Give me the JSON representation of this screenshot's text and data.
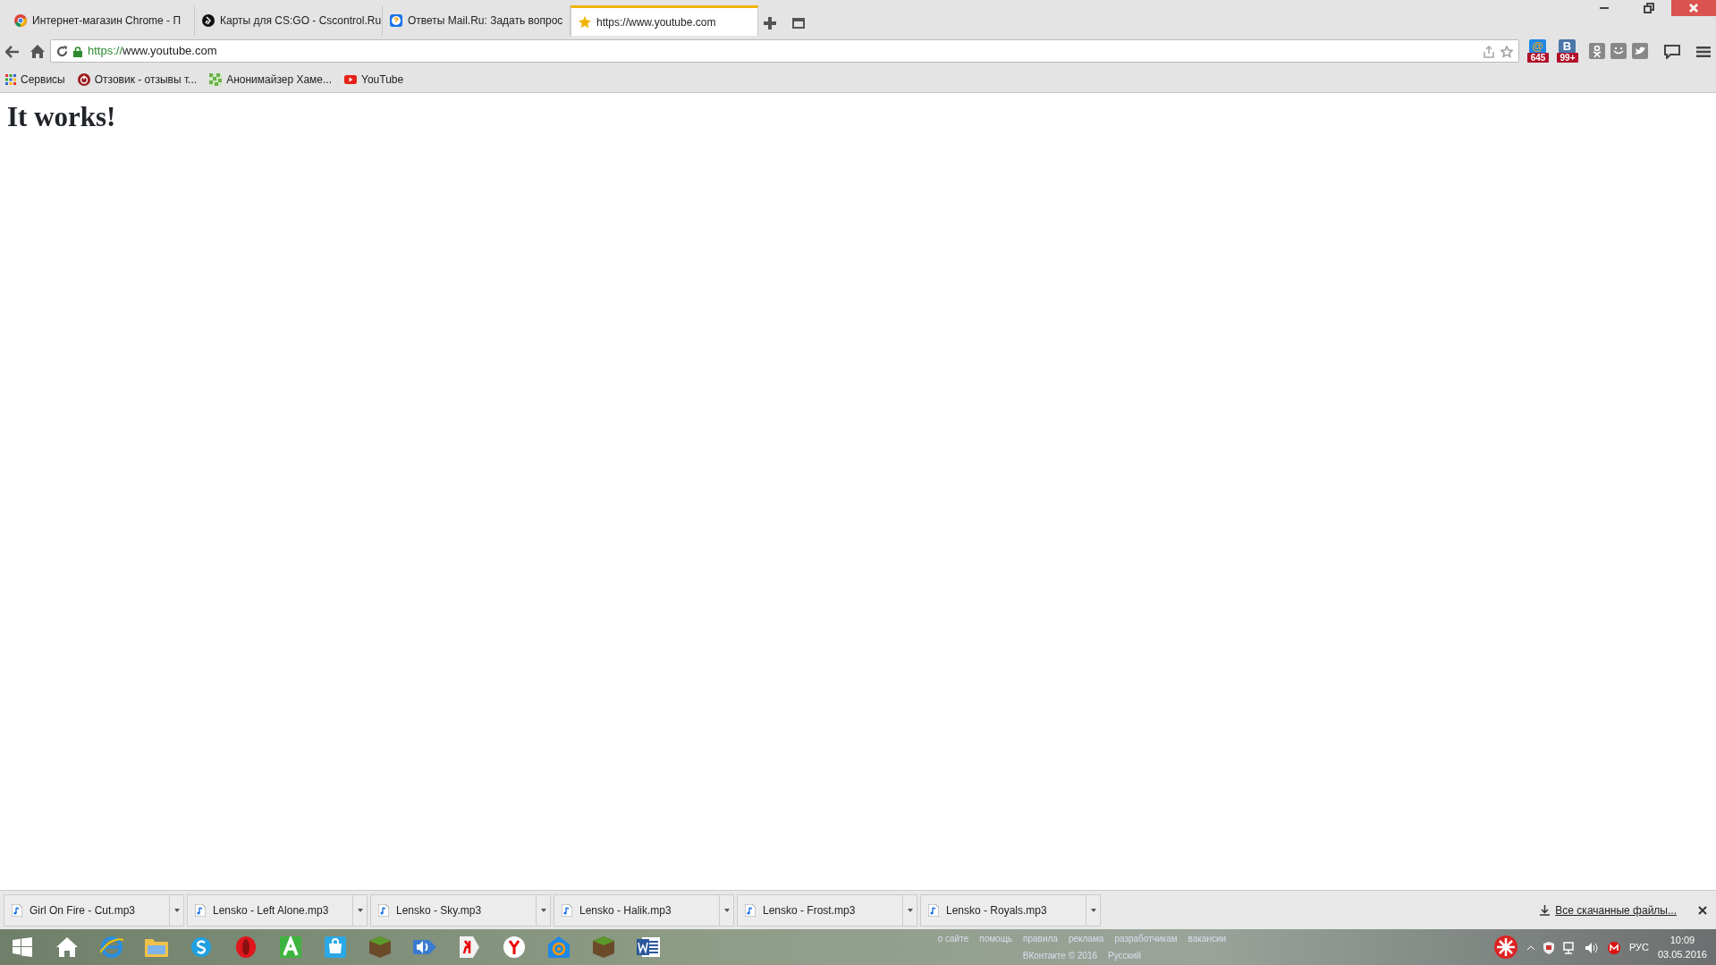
{
  "tabs": [
    {
      "title": "Интернет-магазин Chrome - П",
      "selected": false
    },
    {
      "title": "Карты для CS:GO - Cscontrol.Ru",
      "selected": false
    },
    {
      "title": "Ответы Mail.Ru: Задать вопрос",
      "selected": false
    },
    {
      "title": "https://www.youtube.com",
      "selected": true
    }
  ],
  "address": {
    "scheme": "https://",
    "host": "www.youtube.com"
  },
  "extensions": [
    {
      "glyph": "@",
      "badge": "645"
    },
    {
      "glyph": "B",
      "badge": "99+"
    }
  ],
  "bookmarks": [
    "Сервисы",
    "Отзовик - отзывы т...",
    "Анонимайзер Хаме...",
    "YouTube"
  ],
  "page": {
    "heading": "It works!"
  },
  "downloads": {
    "items": [
      "Girl On Fire - Cut.mp3",
      "Lensko - Left Alone.mp3",
      "Lensko - Sky.mp3",
      "Lensko - Halik.mp3",
      "Lensko - Frost.mp3",
      "Lensko - Royals.mp3"
    ],
    "show_all": "Все скачанные файлы..."
  },
  "footer_behind_taskbar": {
    "links": [
      "о сайте",
      "помощь",
      "правила",
      "реклама",
      "разработчикам",
      "вакансии"
    ],
    "copyright": "ВКонтакте © 2016",
    "language": "Русский"
  },
  "tray": {
    "language": "РУС",
    "time": "10:09",
    "date": "03.05.2016"
  }
}
